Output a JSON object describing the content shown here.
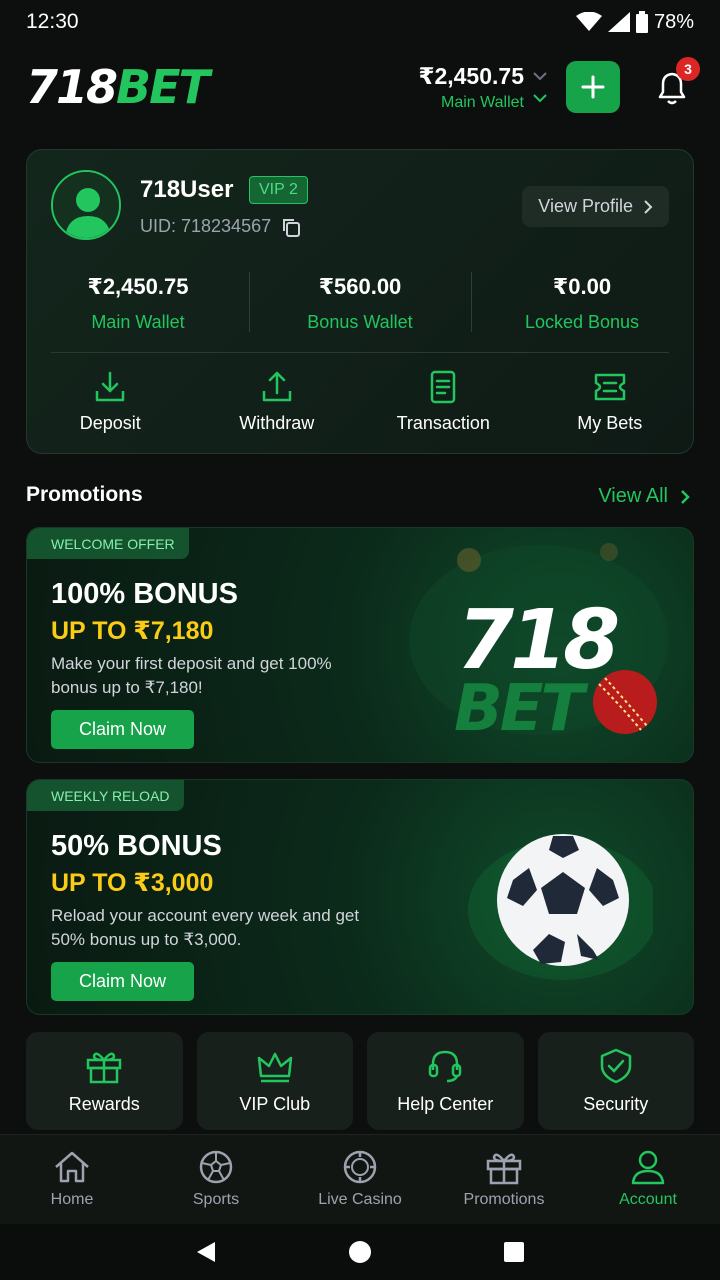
{
  "status": {
    "time": "12:30",
    "battery": "78%"
  },
  "header": {
    "logo_white": "718",
    "logo_green": "BET",
    "wallet_amount": "₹2,450.75",
    "wallet_label": "Main Wallet",
    "notification_count": "3"
  },
  "profile": {
    "username": "718User",
    "vip": "VIP 2",
    "uid": "UID: 718234567",
    "view_profile": "View Profile",
    "balances": [
      {
        "amount": "₹2,450.75",
        "label": "Main Wallet"
      },
      {
        "amount": "₹560.00",
        "label": "Bonus Wallet"
      },
      {
        "amount": "₹0.00",
        "label": "Locked Bonus"
      }
    ],
    "actions": [
      "Deposit",
      "Withdraw",
      "Transaction",
      "My Bets"
    ]
  },
  "promotions": {
    "title": "Promotions",
    "view_all": "View All",
    "cards": [
      {
        "tag": "WELCOME OFFER",
        "title": "100% BONUS",
        "subtitle": "UP TO ₹7,180",
        "desc": "Make your first deposit and get 100% bonus up to ₹7,180!",
        "cta": "Claim Now",
        "art_line1": "718",
        "art_line2": "BET"
      },
      {
        "tag": "WEEKLY RELOAD",
        "title": "50% BONUS",
        "subtitle": "UP TO ₹3,000",
        "desc": "Reload your account every week and get 50% bonus up to ₹3,000.",
        "cta": "Claim Now"
      }
    ]
  },
  "quick_links": [
    "Rewards",
    "VIP Club",
    "Help Center",
    "Security"
  ],
  "tabs": [
    "Home",
    "Sports",
    "Live Casino",
    "Promotions",
    "Account"
  ],
  "colors": {
    "accent": "#22c55e",
    "gold": "#facc15",
    "bg": "#0d0f0e"
  }
}
